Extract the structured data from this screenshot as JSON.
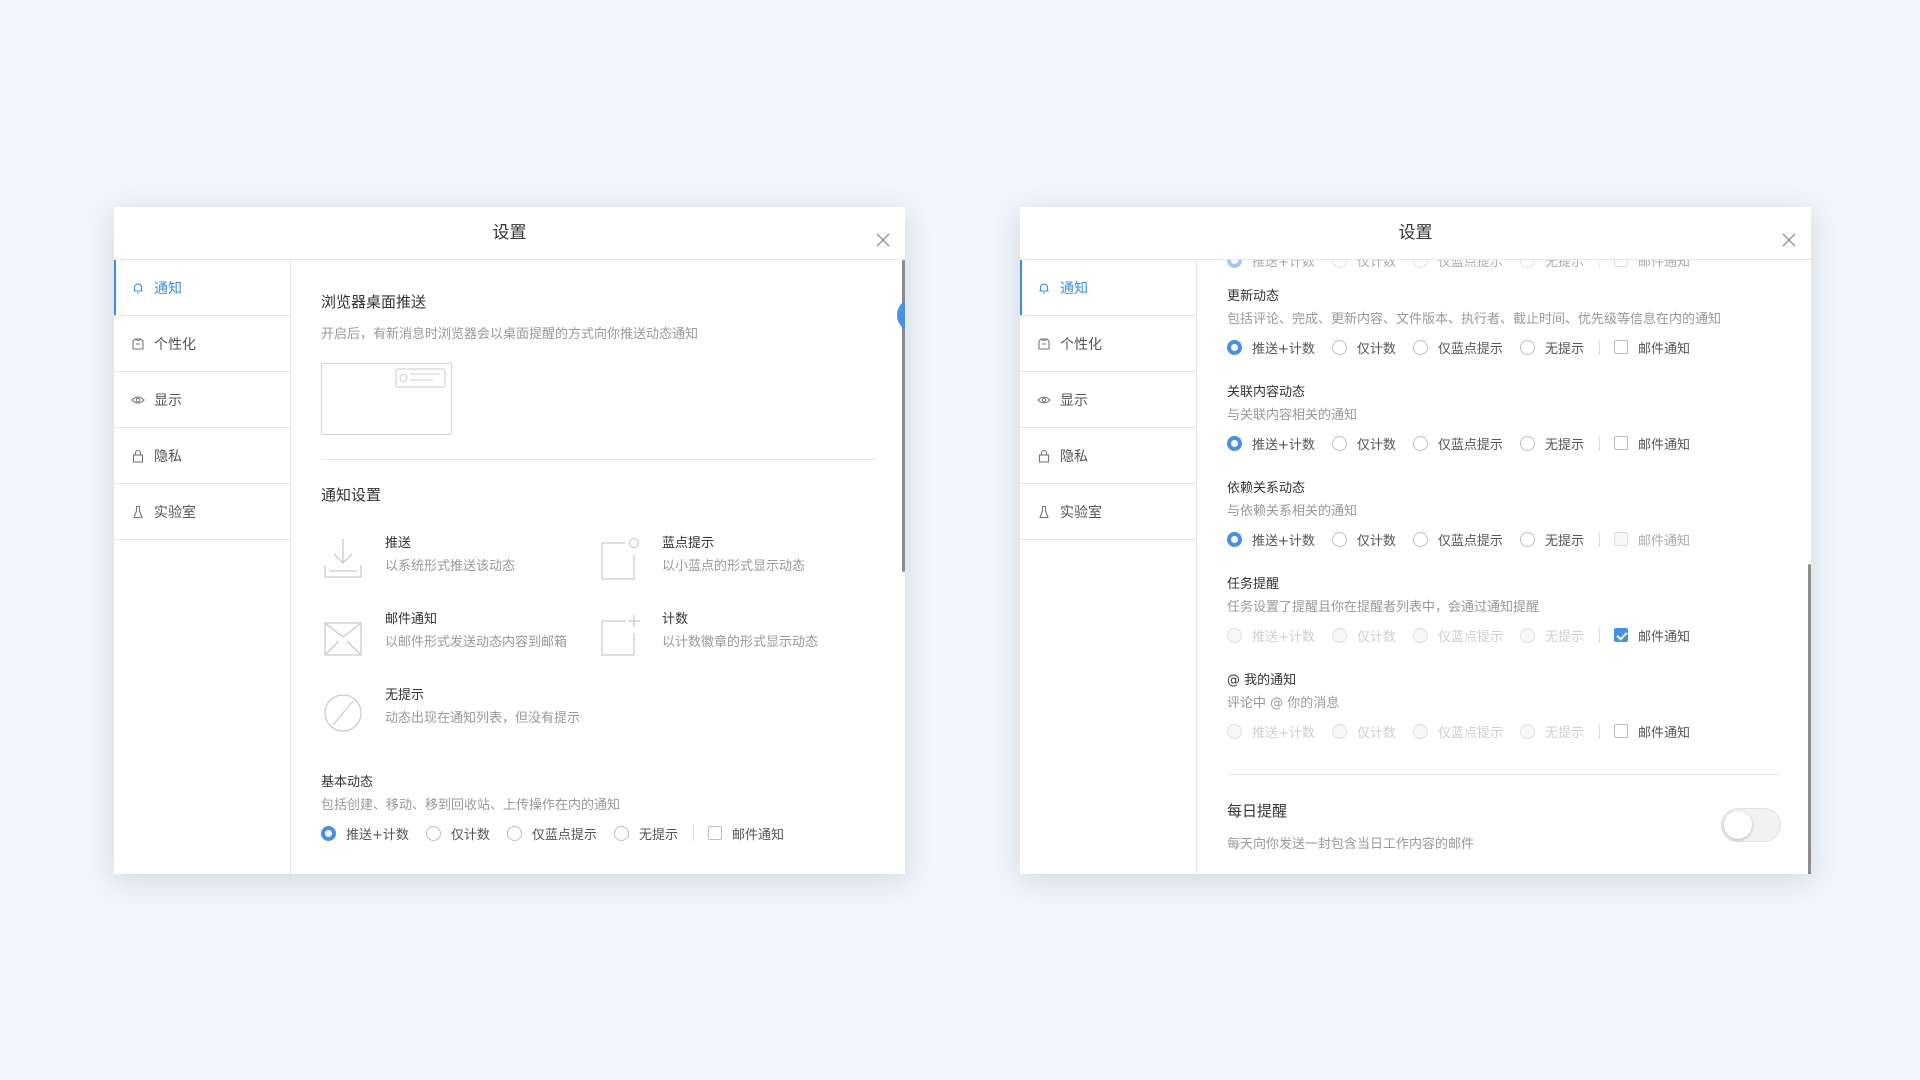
{
  "left_dialog": {
    "title": "设置",
    "sidebar": [
      {
        "label": "通知",
        "icon": "bell-icon",
        "active": true
      },
      {
        "label": "个性化",
        "icon": "shirt-icon",
        "active": false
      },
      {
        "label": "显示",
        "icon": "eye-icon",
        "active": false
      },
      {
        "label": "隐私",
        "icon": "lock-icon",
        "active": false
      },
      {
        "label": "实验室",
        "icon": "flask-icon",
        "active": false
      }
    ],
    "browser_push": {
      "title": "浏览器桌面推送",
      "desc": "开启后，有新消息时浏览器会以桌面提醒的方式向你推送动态通知",
      "enabled": true
    },
    "notify_settings": {
      "title": "通知设置",
      "legend": [
        {
          "title": "推送",
          "desc": "以系统形式推送该动态",
          "icon": "download-tray-icon"
        },
        {
          "title": "蓝点提示",
          "desc": "以小蓝点的形式显示动态",
          "icon": "blue-dot-icon"
        },
        {
          "title": "邮件通知",
          "desc": "以邮件形式发送动态内容到邮箱",
          "icon": "mail-icon"
        },
        {
          "title": "计数",
          "desc": "以计数徽章的形式显示动态",
          "icon": "badge-count-icon"
        },
        {
          "title": "无提示",
          "desc": "动态出现在通知列表，但没有提示",
          "icon": "ban-icon"
        }
      ]
    },
    "basic": {
      "title": "基本动态",
      "desc": "包括创建、移动、移到回收站、上传操作在内的通知"
    }
  },
  "options": {
    "push_count": "推送+计数",
    "count_only": "仅计数",
    "blue_dot_only": "仅蓝点提示",
    "no_hint": "无提示",
    "email": "邮件通知"
  },
  "right_dialog": {
    "title": "设置",
    "sidebar": [
      {
        "label": "通知",
        "icon": "bell-icon",
        "active": true
      },
      {
        "label": "个性化",
        "icon": "shirt-icon",
        "active": false
      },
      {
        "label": "显示",
        "icon": "eye-icon",
        "active": false
      },
      {
        "label": "隐私",
        "icon": "lock-icon",
        "active": false
      },
      {
        "label": "实验室",
        "icon": "flask-icon",
        "active": false
      }
    ],
    "groups": [
      {
        "title": "更新动态",
        "desc": "包括评论、完成、更新内容、文件版本、执行者、截止时间、优先级等信息在内的通知",
        "selected": "push_count",
        "disabled": false,
        "email_checked": false,
        "email_disabled": false
      },
      {
        "title": "关联内容动态",
        "desc": "与关联内容相关的通知",
        "selected": "push_count",
        "disabled": false,
        "email_checked": false,
        "email_disabled": false
      },
      {
        "title": "依赖关系动态",
        "desc": "与依赖关系相关的通知",
        "selected": "push_count",
        "disabled": false,
        "email_checked": false,
        "email_disabled": true
      },
      {
        "title": "任务提醒",
        "desc": "任务设置了提醒且你在提醒者列表中，会通过通知提醒",
        "selected": null,
        "disabled": true,
        "email_checked": true,
        "email_disabled": false
      },
      {
        "title": "@ 我的通知",
        "desc": "评论中 @ 你的消息",
        "selected": null,
        "disabled": true,
        "email_checked": false,
        "email_disabled": false
      }
    ],
    "daily": {
      "title": "每日提醒",
      "desc": "每天向你发送一封包含当日工作内容的邮件",
      "enabled": false
    }
  },
  "colors": {
    "accent": "#4a90e2",
    "background": "#f1f6fa"
  }
}
